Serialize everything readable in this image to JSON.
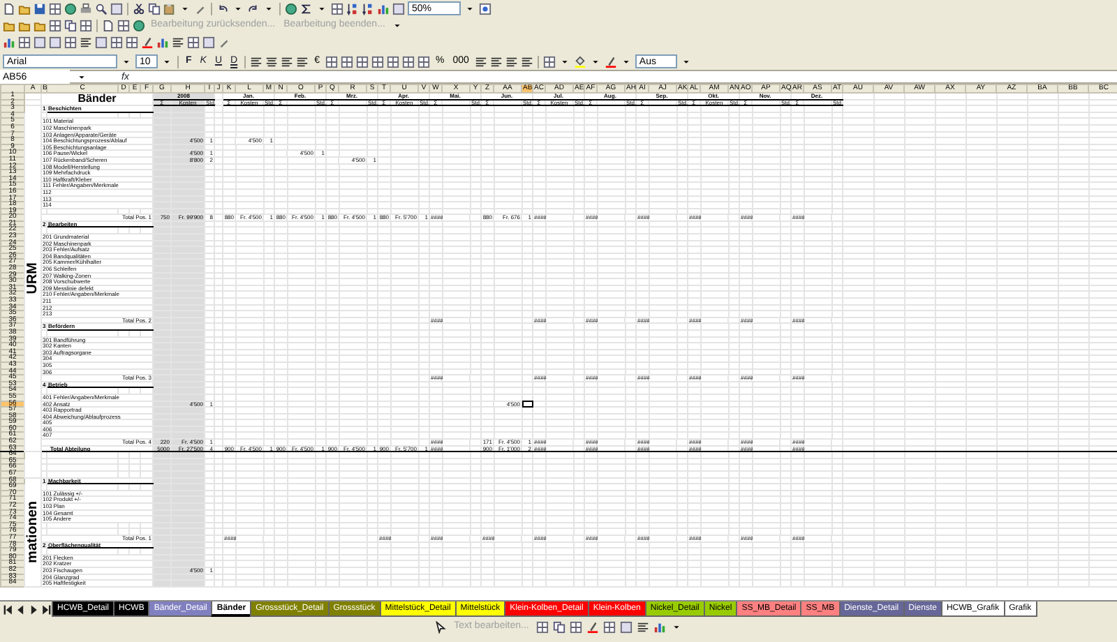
{
  "toolbar": {
    "zoom": "50%",
    "review_buttons": [
      {
        "label": "Bearbeitung zurücksenden...",
        "disabled": true
      },
      {
        "label": "Bearbeitung beenden...",
        "disabled": true
      }
    ],
    "font": "Arial",
    "size": "10",
    "style_buttons": [
      {
        "label": "F",
        "kind": "bold"
      },
      {
        "label": "K",
        "kind": "italic"
      },
      {
        "label": "U",
        "kind": "underline"
      },
      {
        "label": "D",
        "kind": "double"
      }
    ],
    "currency": "€",
    "percent": "%",
    "thousands": "000",
    "style_box": "Aus"
  },
  "formula_bar": {
    "name_box": "AB56",
    "fx": "fx"
  },
  "sheet": {
    "title": "Bänder",
    "year": {
      "label": "2008",
      "subheads": [
        "Σ",
        "Kosten",
        "Std."
      ]
    },
    "months": [
      {
        "label": "Jan.",
        "subheads": [
          "Σ",
          "Kosten",
          "Std."
        ]
      },
      {
        "label": "Feb.",
        "subheads": [
          "Σ",
          "Std."
        ]
      },
      {
        "label": "Mrz.",
        "subheads": [
          "Σ",
          "Std."
        ]
      },
      {
        "label": "Apr.",
        "subheads": [
          "Σ",
          "Kosten",
          "Std."
        ]
      },
      {
        "label": "Mai.",
        "subheads": [
          "Σ",
          "Std."
        ]
      },
      {
        "label": "Jun.",
        "subheads": [
          "Σ",
          "Std."
        ]
      },
      {
        "label": "Jul.",
        "subheads": [
          "Σ",
          "Kosten",
          "Std."
        ]
      },
      {
        "label": "Aug.",
        "subheads": [
          "Σ",
          "Std."
        ]
      },
      {
        "label": "Sep.",
        "subheads": [
          "Σ",
          "Std."
        ]
      },
      {
        "label": "Okt.",
        "subheads": [
          "Σ",
          "Kosten",
          "Std."
        ]
      },
      {
        "label": "Nov.",
        "subheads": [
          "Σ",
          "Std."
        ]
      },
      {
        "label": "Dez.",
        "subheads": [
          "Σ",
          "Std."
        ]
      }
    ],
    "columns": [
      {
        "label": "A",
        "selected": false
      },
      {
        "label": "B",
        "selected": false
      },
      {
        "label": "C",
        "selected": false
      },
      {
        "label": "D",
        "selected": false
      },
      {
        "label": "E",
        "selected": false
      },
      {
        "label": "F",
        "selected": false
      },
      {
        "label": "G",
        "selected": false
      },
      {
        "label": "H",
        "selected": false
      },
      {
        "label": "I",
        "selected": false
      },
      {
        "label": "J",
        "selected": false
      },
      {
        "label": "K",
        "selected": false
      },
      {
        "label": "L",
        "selected": false
      },
      {
        "label": "M",
        "selected": false
      },
      {
        "label": "N",
        "selected": false
      },
      {
        "label": "O",
        "selected": false
      },
      {
        "label": "P",
        "selected": false
      },
      {
        "label": "Q",
        "selected": false
      },
      {
        "label": "R",
        "selected": false
      },
      {
        "label": "S",
        "selected": false
      },
      {
        "label": "T",
        "selected": false
      },
      {
        "label": "U",
        "selected": false
      },
      {
        "label": "V",
        "selected": false
      },
      {
        "label": "W",
        "selected": false
      },
      {
        "label": "X",
        "selected": false
      },
      {
        "label": "Y",
        "selected": false
      },
      {
        "label": "Z",
        "selected": false
      },
      {
        "label": "AA",
        "selected": false
      },
      {
        "label": "AB",
        "selected": true
      },
      {
        "label": "AC",
        "selected": false
      },
      {
        "label": "AD",
        "selected": false
      },
      {
        "label": "AE",
        "selected": false
      },
      {
        "label": "AF",
        "selected": false
      },
      {
        "label": "AG",
        "selected": false
      },
      {
        "label": "AH",
        "selected": false
      },
      {
        "label": "AI",
        "selected": false
      },
      {
        "label": "AJ",
        "selected": false
      },
      {
        "label": "AK",
        "selected": false
      },
      {
        "label": "AL",
        "selected": false
      },
      {
        "label": "AM",
        "selected": false
      },
      {
        "label": "AN",
        "selected": false
      },
      {
        "label": "AO",
        "selected": false
      },
      {
        "label": "AP",
        "selected": false
      },
      {
        "label": "AQ",
        "selected": false
      },
      {
        "label": "AR",
        "selected": false
      },
      {
        "label": "AS",
        "selected": false
      },
      {
        "label": "AT",
        "selected": false
      },
      {
        "label": "AU",
        "selected": false
      },
      {
        "label": "AV",
        "selected": false
      },
      {
        "label": "AW",
        "selected": false
      },
      {
        "label": "AX",
        "selected": false
      },
      {
        "label": "AY",
        "selected": false
      },
      {
        "label": "AZ",
        "selected": false
      },
      {
        "label": "BA",
        "selected": false
      },
      {
        "label": "BB",
        "selected": false
      },
      {
        "label": "BC",
        "selected": false
      }
    ],
    "header_rows": [
      {
        "n": "1",
        "selected": false
      },
      {
        "n": "2",
        "selected": false
      }
    ],
    "groups": [
      {
        "label": "URM",
        "rows": [
          {
            "kind": "section",
            "n": "3",
            "selected": false,
            "num": "1",
            "title": "Beschichten"
          },
          {
            "kind": "blank",
            "n": "4",
            "selected": false
          },
          {
            "kind": "item",
            "n": "5",
            "selected": false,
            "label": "101 Material"
          },
          {
            "kind": "item",
            "n": "6",
            "selected": false,
            "label": "102 Maschinenpark"
          },
          {
            "kind": "item",
            "n": "7",
            "selected": false,
            "label": "103 Anlagen/Apparate/Geräte"
          },
          {
            "kind": "item",
            "n": "8",
            "selected": false,
            "label": "104 Beschichtungsprozess/Ablauf",
            "year": {
              "cost": "4'500",
              "hours": "1"
            },
            "months": {
              "jan": {
                "cost": "4'500",
                "hours": "1"
              }
            }
          },
          {
            "kind": "item",
            "n": "9",
            "selected": false,
            "label": "105 Beschichtungsanlage"
          },
          {
            "kind": "item",
            "n": "10",
            "selected": false,
            "label": "106 Pause/Wickel",
            "year": {
              "cost": "4'500",
              "hours": "1"
            },
            "months": {
              "feb": {
                "cost": "4'500",
                "hours": "1"
              }
            }
          },
          {
            "kind": "item",
            "n": "11",
            "selected": false,
            "label": "107 Rückenband/Scheren",
            "year": {
              "cost": "8'800",
              "hours": "2"
            },
            "months": {
              "mar": {
                "cost": "4'500",
                "hours": "1"
              }
            }
          },
          {
            "kind": "item",
            "n": "12",
            "selected": false,
            "label": "108 Modell/Herstellung"
          },
          {
            "kind": "item",
            "n": "13",
            "selected": false,
            "label": "109 Mehrfachdruck"
          },
          {
            "kind": "item",
            "n": "14",
            "selected": false,
            "label": "110 Haftkraft/Kleber"
          },
          {
            "kind": "item",
            "n": "15",
            "selected": false,
            "label": "111 Fehler/Angaben/Merkmale"
          },
          {
            "kind": "item",
            "n": "16",
            "selected": false,
            "label": "112"
          },
          {
            "kind": "item",
            "n": "17",
            "selected": false,
            "label": "113"
          },
          {
            "kind": "item",
            "n": "18",
            "selected": false,
            "label": "114"
          },
          {
            "kind": "blank",
            "n": "19",
            "selected": false
          },
          {
            "kind": "total",
            "n": "20",
            "selected": false,
            "label": "Total Pos. 1",
            "year": {
              "sum": "750",
              "cost": "Fr. 99'900",
              "hours": "8"
            },
            "months": {
              "jan": {
                "sum": "880",
                "cost": "Fr. 4'500",
                "hours": "1"
              },
              "feb": {
                "sum": "880",
                "cost": "Fr. 4'500",
                "hours": "1"
              },
              "mar": {
                "sum": "880",
                "cost": "Fr. 4'500",
                "hours": "1"
              },
              "apr": {
                "sum": "880",
                "cost": "Fr. 5'700",
                "hours": "1"
              },
              "may": {
                "sum": "####"
              },
              "jun": {
                "sum": "880",
                "cost": "Fr. 676",
                "hours": "1"
              },
              "jul": {
                "sum": "####"
              },
              "aug": {
                "sum": "####"
              },
              "sep": {
                "sum": "####"
              },
              "oct": {
                "sum": "####"
              },
              "nov": {
                "sum": "####"
              },
              "dec": {
                "sum": "####"
              }
            }
          },
          {
            "kind": "section",
            "n": "21",
            "selected": false,
            "num": "2",
            "title": "Bearbeiten"
          },
          {
            "kind": "blank",
            "n": "22",
            "selected": false
          },
          {
            "kind": "item",
            "n": "23",
            "selected": false,
            "label": "201 Grundmaterial"
          },
          {
            "kind": "item",
            "n": "24",
            "selected": false,
            "label": "202 Maschinenpark"
          },
          {
            "kind": "item",
            "n": "25",
            "selected": false,
            "label": "203 Fehler/Aufsatz"
          },
          {
            "kind": "item",
            "n": "26",
            "selected": false,
            "label": "204 Bandqualitäten"
          },
          {
            "kind": "item",
            "n": "27",
            "selected": false,
            "label": "205 Kammer/Kühlhalter"
          },
          {
            "kind": "item",
            "n": "28",
            "selected": false,
            "label": "206 Schleifen"
          },
          {
            "kind": "item",
            "n": "29",
            "selected": false,
            "label": "207 Walking-Zonen"
          },
          {
            "kind": "item",
            "n": "30",
            "selected": false,
            "label": "208 Vorschubwerte"
          },
          {
            "kind": "item",
            "n": "31",
            "selected": false,
            "label": "209 Messlinie defekt"
          },
          {
            "kind": "item",
            "n": "32",
            "selected": false,
            "label": "210 Fehler/Angaben/Merkmale"
          },
          {
            "kind": "item",
            "n": "33",
            "selected": false,
            "label": "211"
          },
          {
            "kind": "item",
            "n": "34",
            "selected": false,
            "label": "212"
          },
          {
            "kind": "item",
            "n": "35",
            "selected": false,
            "label": "213"
          },
          {
            "kind": "total",
            "n": "36",
            "selected": false,
            "label": "Total Pos. 2",
            "months": {
              "may": {
                "sum": "####"
              },
              "jul": {
                "sum": "####"
              },
              "aug": {
                "sum": "####"
              },
              "sep": {
                "sum": "####"
              },
              "oct": {
                "sum": "####"
              },
              "nov": {
                "sum": "####"
              },
              "dec": {
                "sum": "####"
              }
            }
          },
          {
            "kind": "section",
            "n": "37",
            "selected": false,
            "num": "3",
            "title": "Befördern"
          },
          {
            "kind": "blank",
            "n": "38",
            "selected": false
          },
          {
            "kind": "item",
            "n": "39",
            "selected": false,
            "label": "301 Bandführung"
          },
          {
            "kind": "item",
            "n": "40",
            "selected": false,
            "label": "302 Kanten"
          },
          {
            "kind": "item",
            "n": "41",
            "selected": false,
            "label": "303 Auftragsorgane"
          },
          {
            "kind": "item",
            "n": "42",
            "selected": false,
            "label": "304"
          },
          {
            "kind": "item",
            "n": "43",
            "selected": false,
            "label": "305"
          },
          {
            "kind": "item",
            "n": "44",
            "selected": false,
            "label": "306"
          },
          {
            "kind": "total",
            "n": "45",
            "selected": false,
            "label": "Total Pos. 3",
            "months": {
              "may": {
                "sum": "####"
              },
              "jul": {
                "sum": "####"
              },
              "aug": {
                "sum": "####"
              },
              "sep": {
                "sum": "####"
              },
              "oct": {
                "sum": "####"
              },
              "nov": {
                "sum": "####"
              },
              "dec": {
                "sum": "####"
              }
            }
          },
          {
            "kind": "section",
            "n": "53",
            "selected": false,
            "num": "4",
            "title": "Betrieb"
          },
          {
            "kind": "blank",
            "n": "54",
            "selected": false
          },
          {
            "kind": "item",
            "n": "55",
            "selected": false,
            "label": "401 Fehler/Angaben/Merkmale"
          },
          {
            "kind": "item",
            "n": "56",
            "selected": true,
            "label": "402 Ansatz",
            "year": {
              "cost": "4'500",
              "hours": "1"
            },
            "months": {
              "jun": {
                "cost": "4'500"
              }
            }
          },
          {
            "kind": "item",
            "n": "57",
            "selected": false,
            "label": "403 Rapportrad"
          },
          {
            "kind": "item",
            "n": "58",
            "selected": false,
            "label": "404 Abweichung/Ablaufprozess"
          },
          {
            "kind": "item",
            "n": "59",
            "selected": false,
            "label": "405"
          },
          {
            "kind": "item",
            "n": "60",
            "selected": false,
            "label": "406"
          },
          {
            "kind": "item",
            "n": "61",
            "selected": false,
            "label": "407"
          },
          {
            "kind": "total",
            "n": "62",
            "selected": false,
            "label": "Total Pos. 4",
            "year": {
              "sum": "220",
              "cost": "Fr. 4'500",
              "hours": "1"
            },
            "months": {
              "may": {
                "sum": "####"
              },
              "jun": {
                "sum": "171",
                "cost": "Fr. 4'500",
                "hours": "1"
              },
              "jul": {
                "sum": "####"
              },
              "aug": {
                "sum": "####"
              },
              "sep": {
                "sum": "####"
              },
              "oct": {
                "sum": "####"
              },
              "nov": {
                "sum": "####"
              },
              "dec": {
                "sum": "####"
              }
            }
          },
          {
            "kind": "grand",
            "n": "63",
            "selected": false,
            "label": "Total Abteilung",
            "year": {
              "sum": "5000",
              "cost": "Fr. 27'500",
              "hours": "4"
            },
            "months": {
              "jan": {
                "sum": "900",
                "cost": "Fr. 4'500",
                "hours": "1"
              },
              "feb": {
                "sum": "900",
                "cost": "Fr. 4'500",
                "hours": "1"
              },
              "mar": {
                "sum": "900",
                "cost": "Fr. 4'500",
                "hours": "1"
              },
              "apr": {
                "sum": "900",
                "cost": "Fr. 5'700",
                "hours": "1"
              },
              "may": {
                "sum": "####"
              },
              "jun": {
                "sum": "900",
                "cost": "Fr. 1'000",
                "hours": "2"
              },
              "jul": {
                "sum": "####"
              },
              "aug": {
                "sum": "####"
              },
              "sep": {
                "sum": "####"
              },
              "oct": {
                "sum": "####"
              },
              "nov": {
                "sum": "####"
              },
              "dec": {
                "sum": "####"
              }
            }
          }
        ]
      },
      {
        "rows": [
          {
            "kind": "blank",
            "n": "64",
            "selected": false
          },
          {
            "kind": "blank",
            "n": "65",
            "selected": false
          },
          {
            "kind": "blank",
            "n": "66",
            "selected": false
          },
          {
            "kind": "blank",
            "n": "67",
            "selected": false
          }
        ]
      },
      {
        "label": "mationen",
        "rows": [
          {
            "kind": "section",
            "n": "68",
            "selected": false,
            "num": "1",
            "title": "Machbarkeit"
          },
          {
            "kind": "blank",
            "n": "69",
            "selected": false
          },
          {
            "kind": "item",
            "n": "70",
            "selected": false,
            "label": "101 Zulässig +/-"
          },
          {
            "kind": "item",
            "n": "71",
            "selected": false,
            "label": "102 Produkt +/-"
          },
          {
            "kind": "item",
            "n": "72",
            "selected": false,
            "label": "103 Plan"
          },
          {
            "kind": "item",
            "n": "73",
            "selected": false,
            "label": "104 Gesamt"
          },
          {
            "kind": "item",
            "n": "74",
            "selected": false,
            "label": "105 Andere"
          },
          {
            "kind": "blank",
            "n": "75",
            "selected": false
          },
          {
            "kind": "blank",
            "n": "76",
            "selected": false
          },
          {
            "kind": "total",
            "n": "77",
            "selected": false,
            "label": "Total Pos. 1",
            "months": {
              "jan": {
                "sum": "####"
              },
              "apr": {
                "sum": "####"
              },
              "may": {
                "sum": "####"
              },
              "jun": {
                "sum": "####"
              },
              "jul": {
                "sum": "####"
              },
              "aug": {
                "sum": "####"
              },
              "sep": {
                "sum": "####"
              },
              "oct": {
                "sum": "####"
              },
              "nov": {
                "sum": "####"
              },
              "dec": {
                "sum": "####"
              }
            }
          },
          {
            "kind": "section",
            "n": "78",
            "selected": false,
            "num": "2",
            "title": "Oberflächenqualität"
          },
          {
            "kind": "blank",
            "n": "79",
            "selected": false
          },
          {
            "kind": "item",
            "n": "80",
            "selected": false,
            "label": "201 Flecken"
          },
          {
            "kind": "item",
            "n": "81",
            "selected": false,
            "label": "202 Kratzer"
          },
          {
            "kind": "item",
            "n": "82",
            "selected": false,
            "label": "203 Fischaugen",
            "year": {
              "cost": "4'500",
              "hours": "1"
            }
          },
          {
            "kind": "item",
            "n": "83",
            "selected": false,
            "label": "204 Glanzgrad"
          },
          {
            "kind": "item",
            "n": "84",
            "selected": false,
            "label": "205 Haftfestigkeit"
          }
        ]
      }
    ]
  },
  "sheet_tabs": [
    {
      "label": "HCWB_Detail",
      "color": "#000000",
      "selected": false
    },
    {
      "label": "HCWB",
      "color": "#000000",
      "selected": false
    },
    {
      "label": "Bänder_Detail",
      "color": "#8080c0",
      "selected": false
    },
    {
      "label": "Bänder",
      "color": "#ffffff",
      "selected": true
    },
    {
      "label": "Grossstück_Detail",
      "color": "#808000",
      "selected": false
    },
    {
      "label": "Grossstück",
      "color": "#808000",
      "selected": false
    },
    {
      "label": "Mittelstück_Detail",
      "color": "#ffff00",
      "selected": false
    },
    {
      "label": "Mittelstück",
      "color": "#ffff00",
      "selected": false
    },
    {
      "label": "Klein-Kolben_Detail",
      "color": "#ff0000",
      "selected": false
    },
    {
      "label": "Klein-Kolben",
      "color": "#ff0000",
      "selected": false
    },
    {
      "label": "Nickel_Detail",
      "color": "#99cc00",
      "selected": false
    },
    {
      "label": "Nickel",
      "color": "#99cc00",
      "selected": false
    },
    {
      "label": "SS_MB_Detail",
      "color": "#ff8080",
      "selected": false
    },
    {
      "label": "SS_MB",
      "color": "#ff8080",
      "selected": false
    },
    {
      "label": "Dienste_Detail",
      "color": "#666699",
      "selected": false
    },
    {
      "label": "Dienste",
      "color": "#666699",
      "selected": false
    },
    {
      "label": "HCWB_Grafik",
      "color": "#ffffff",
      "selected": false
    },
    {
      "label": "Grafik",
      "color": "#ffffff",
      "selected": false
    }
  ],
  "bottom_toolbar": {
    "text_button": {
      "label": "Text bearbeiten...",
      "disabled": true
    }
  }
}
